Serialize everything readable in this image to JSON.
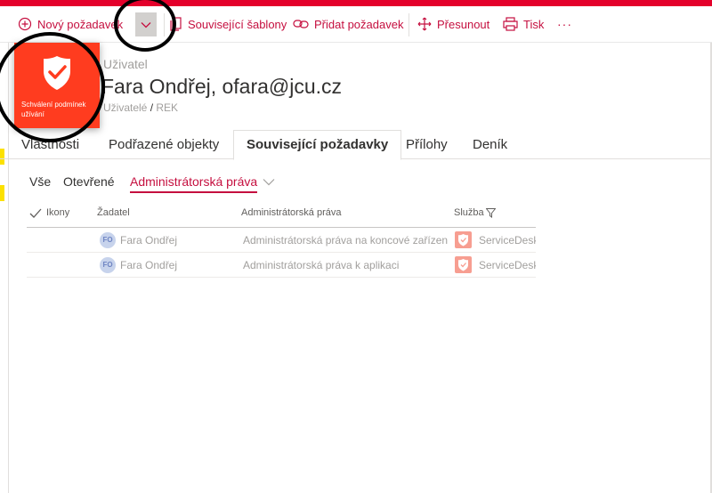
{
  "toolbar": {
    "new_request_label": "Nový požadavek",
    "related_templates_label": "Související šablony",
    "add_request_label": "Přidat požadavek",
    "move_label": "Přesunout",
    "print_label": "Tisk",
    "more_label": "···"
  },
  "tile": {
    "label": "Schválení podmínek užívání",
    "color": "#ff3c1f"
  },
  "header": {
    "category": "Uživatel",
    "title": "Fara Ondřej, ofara@jcu.cz",
    "breadcrumb_parent": "Uživatelé",
    "breadcrumb_sep": " / ",
    "breadcrumb_current": "REK"
  },
  "tabs": [
    {
      "label": "Vlastnosti"
    },
    {
      "label": "Podřazené objekty"
    },
    {
      "label": "Související požadavky"
    },
    {
      "label": "Přílohy"
    },
    {
      "label": "Deník"
    }
  ],
  "filters": [
    {
      "label": "Vše"
    },
    {
      "label": "Otevřené"
    },
    {
      "label": "Administrátorská práva"
    }
  ],
  "grid": {
    "columns": [
      "Ikony",
      "Žadatel",
      "Administrátorská práva",
      "Služba"
    ],
    "rows": [
      {
        "initials": "FO",
        "requester": "Fara Ondřej",
        "rights": "Administrátorská práva na koncové zařízení",
        "service": "ServiceDesk"
      },
      {
        "initials": "FO",
        "requester": "Fara Ondřej",
        "rights": "Administrátorská práva k aplikaci",
        "service": "ServiceDesk"
      }
    ]
  },
  "colors": {
    "accent": "#c50f3f",
    "topbar": "#e4002b"
  }
}
